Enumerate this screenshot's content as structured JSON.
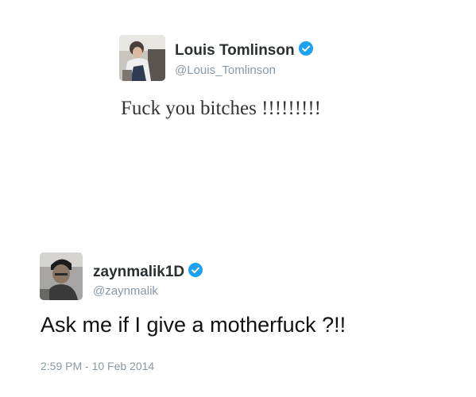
{
  "tweets": [
    {
      "display_name": "Louis Tomlinson",
      "handle": "@Louis_Tomlinson",
      "verified": true,
      "text": "Fuck you bitches !!!!!!!!!"
    },
    {
      "display_name": "zaynmalik1D",
      "handle": "@zaynmalik",
      "verified": true,
      "text": "Ask me if I give a motherfuck ?!!",
      "timestamp": "2:59 PM - 10 Feb 2014"
    }
  ],
  "colors": {
    "verified_badge": "#1da1f2",
    "handle": "#8899a6",
    "name": "#292f33"
  }
}
